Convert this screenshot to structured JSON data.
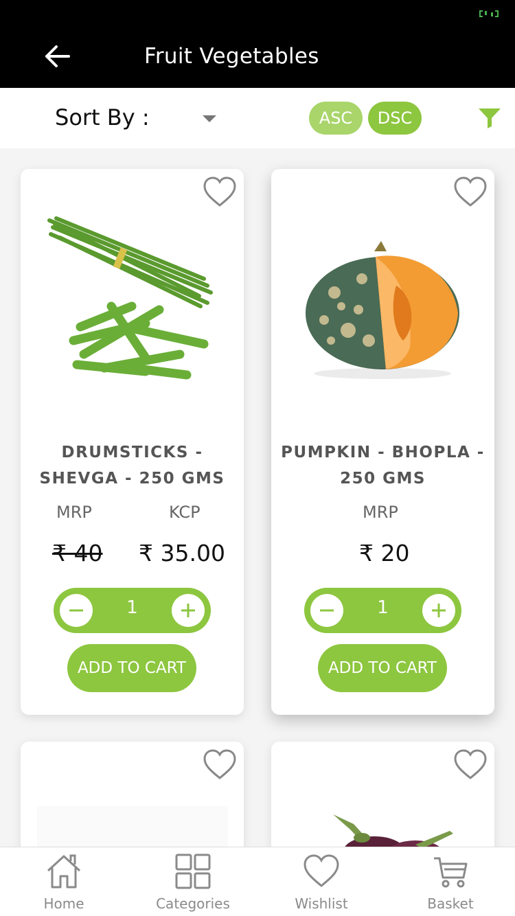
{
  "header": {
    "title": "Fruit Vegetables"
  },
  "sort": {
    "label": "Sort By :",
    "asc_label": "ASC",
    "dsc_label": "DSC"
  },
  "products": [
    {
      "name": "DRUMSTICKS - SHEVGA - 250 GMS",
      "mrp_label": "MRP",
      "kcp_label": "KCP",
      "mrp_price": "₹ 40",
      "kcp_price": "₹ 35.00",
      "qty": "1",
      "add_label": "ADD TO CART",
      "image": "drumsticks-image"
    },
    {
      "name": "PUMPKIN - BHOPLA - 250 GMS",
      "mrp_label": "MRP",
      "mrp_price": "₹ 20",
      "qty": "1",
      "add_label": "ADD TO CART",
      "image": "pumpkin-image"
    },
    {
      "image": "blank-image"
    },
    {
      "image": "brinjal-image"
    }
  ],
  "nav": [
    {
      "label": "Home",
      "icon": "home-icon"
    },
    {
      "label": "Categories",
      "icon": "grid-icon"
    },
    {
      "label": "Wishlist",
      "icon": "heart-icon"
    },
    {
      "label": "Basket",
      "icon": "cart-icon"
    }
  ],
  "colors": {
    "accent": "#8dc63f",
    "accent_light": "#a9d56a",
    "header_bg": "#000000"
  }
}
